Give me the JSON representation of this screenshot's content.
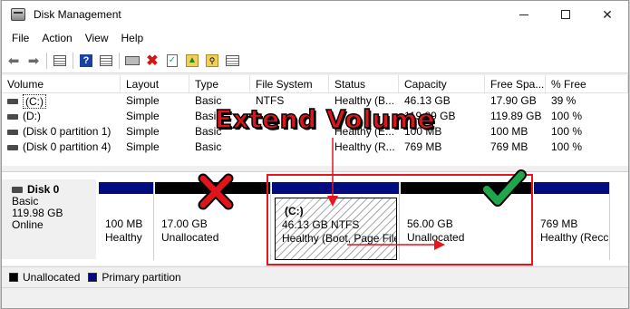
{
  "window": {
    "title": "Disk Management"
  },
  "menu": [
    "File",
    "Action",
    "View",
    "Help"
  ],
  "toolbar": {
    "icons": [
      "back-icon",
      "forward-icon",
      "grid-view-icon",
      "help-icon",
      "properties-icon",
      "connect-disk-icon",
      "delete-icon",
      "check-icon",
      "folder-up-icon",
      "folder-search-icon",
      "list-view-icon"
    ]
  },
  "volume_table": {
    "columns": [
      "Volume",
      "Layout",
      "Type",
      "File System",
      "Status",
      "Capacity",
      "Free Spa...",
      "% Free"
    ],
    "rows": [
      [
        "(C:)",
        "Simple",
        "Basic",
        "NTFS",
        "Healthy (B...",
        "46.13 GB",
        "17.90 GB",
        "39 %"
      ],
      [
        "(D:)",
        "Simple",
        "Basic",
        "",
        "",
        "119.89 GB",
        "119.89 GB",
        "100 %"
      ],
      [
        "(Disk 0 partition 1)",
        "Simple",
        "Basic",
        "",
        "Healthy (E...",
        "100 MB",
        "100 MB",
        "100 %"
      ],
      [
        "(Disk 0 partition 4)",
        "Simple",
        "Basic",
        "",
        "Healthy (R...",
        "769 MB",
        "769 MB",
        "100 %"
      ]
    ]
  },
  "disk": {
    "name": "Disk 0",
    "type": "Basic",
    "size": "119.98 GB",
    "status": "Online",
    "partitions": [
      {
        "line1": "100 MB",
        "line2": "Healthy"
      },
      {
        "line1": "17.00 GB",
        "line2": "Unallocated"
      },
      {
        "label": "(C:)",
        "line1": "46.13 GB NTFS",
        "line2": "Healthy (Boot, Page File"
      },
      {
        "line1": "56.00 GB",
        "line2": "Unallocated"
      },
      {
        "line1": "769 MB",
        "line2": "Healthy (Recc"
      }
    ]
  },
  "legend": {
    "unallocated": "Unallocated",
    "primary": "Primary partition"
  },
  "annotation": {
    "title": "Extend Volume",
    "colors": {
      "red": "#e0141b",
      "green": "#1fa64a",
      "outline": "#e5161d"
    }
  }
}
